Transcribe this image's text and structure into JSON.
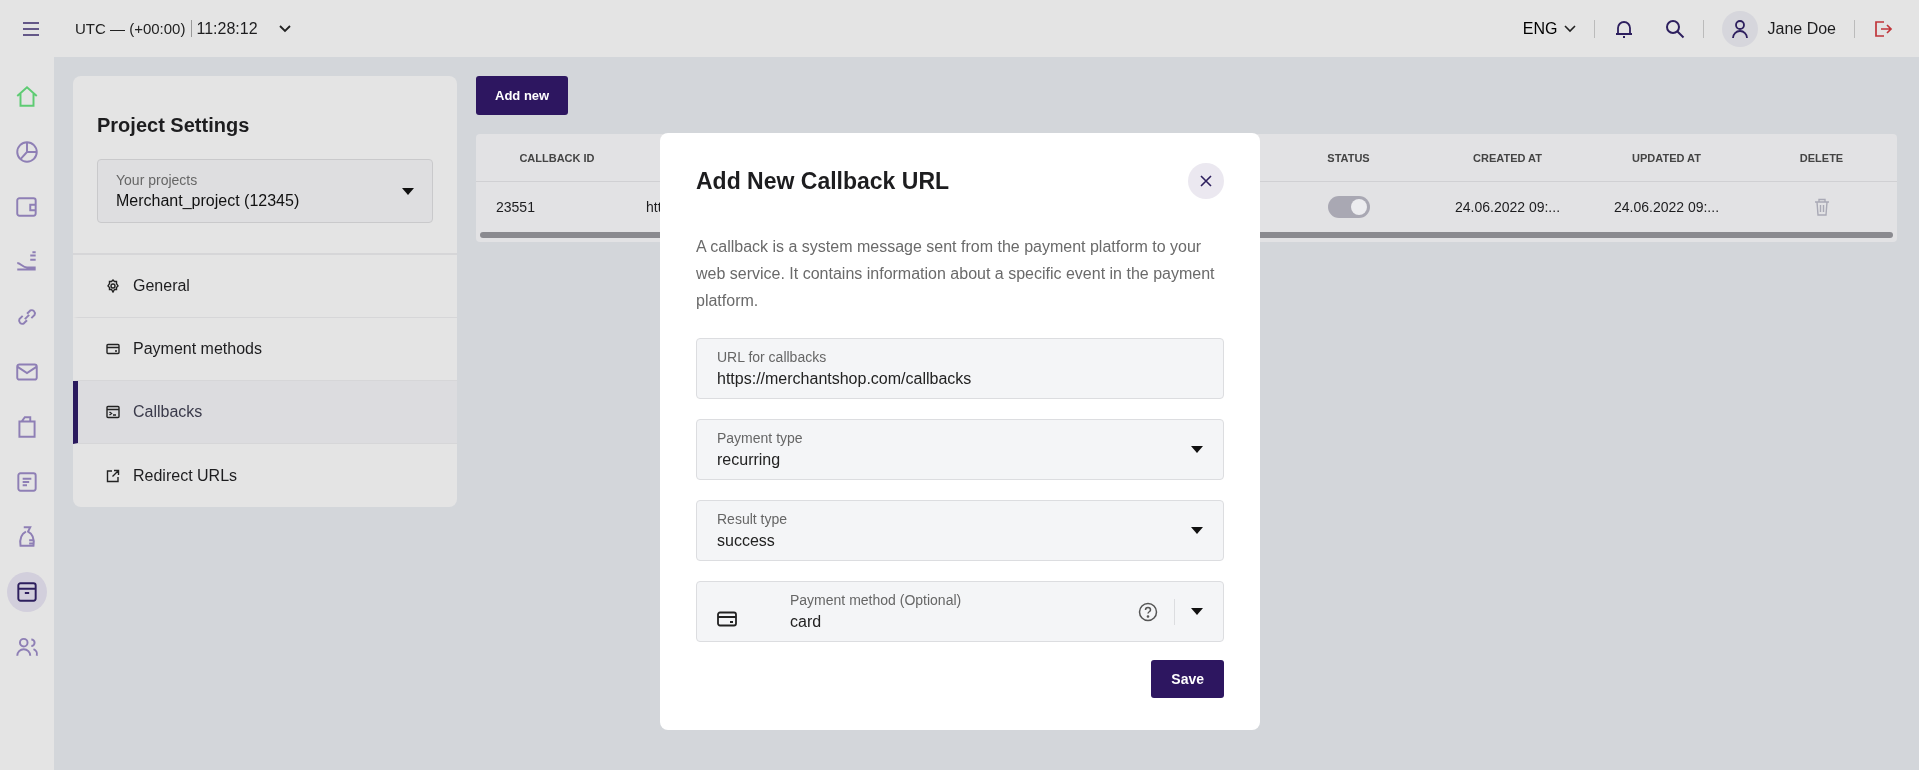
{
  "top_bar": {
    "timezone": "UTC — (+00:00)",
    "time": "11:28:12",
    "language": "ENG",
    "user_name": "Jane Doe"
  },
  "rail": {
    "items": [
      {
        "selected": false
      },
      {
        "selected": false
      },
      {
        "selected": false
      },
      {
        "selected": false
      },
      {
        "selected": false
      },
      {
        "selected": false
      },
      {
        "selected": false
      },
      {
        "selected": false
      },
      {
        "selected": false
      },
      {
        "selected": true
      },
      {
        "selected": false
      }
    ]
  },
  "settings_panel": {
    "title": "Project Settings",
    "project_select": {
      "label": "Your projects",
      "value": "Merchant_project (12345)"
    },
    "items": [
      {
        "label": "General",
        "selected": false
      },
      {
        "label": "Payment methods",
        "selected": false
      },
      {
        "label": "Callbacks",
        "selected": true
      },
      {
        "label": "Redirect URLs",
        "selected": false
      }
    ]
  },
  "add_button": "Add new",
  "table": {
    "columns": [
      "CALLBACK ID",
      "",
      "STATUS",
      "CREATED AT",
      "UPDATED AT",
      "DELETE"
    ],
    "rows": [
      {
        "callback_id": "23551",
        "column_2": "htt",
        "status_on": true,
        "created_at": "24.06.2022 09:...",
        "updated_at": "24.06.2022 09:..."
      }
    ]
  },
  "dialog": {
    "title": "Add New Callback URL",
    "description": "A callback is a system message sent from the payment platform to your web service. It contains information about a specific event in the payment platform.",
    "fields": [
      {
        "kind": "text",
        "label": "URL for callbacks",
        "value": "https://merchantshop.com/callbacks"
      },
      {
        "kind": "select",
        "label": "Payment type",
        "value": "recurring"
      },
      {
        "kind": "select",
        "label": "Result type",
        "value": "success"
      },
      {
        "kind": "select_help",
        "label": "Payment method (Optional)",
        "value": "card"
      }
    ],
    "save_button": "Save"
  }
}
